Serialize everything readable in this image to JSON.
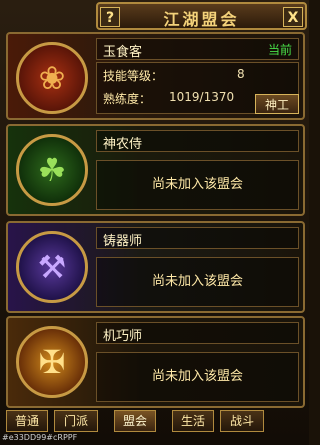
{
  "window": {
    "title": "江湖盟会",
    "help_label": "?",
    "close_label": "X"
  },
  "professions": [
    {
      "name": "玉食客",
      "current": "当前",
      "skill_level_label": "技能等级：",
      "skill_level_value": "8",
      "proficiency_label": "熟练度：",
      "proficiency_value": "1019/1370",
      "button": "神工",
      "icon": "yushike-emblem-icon"
    },
    {
      "name": "神农侍",
      "status": "尚未加入该盟会",
      "icon": "shennongshi-emblem-icon"
    },
    {
      "name": "铸器师",
      "status": "尚未加入该盟会",
      "icon": "zhuqishi-emblem-icon"
    },
    {
      "name": "机巧师",
      "status": "尚未加入该盟会",
      "icon": "jiqiaoshi-emblem-icon"
    }
  ],
  "tabs": [
    {
      "label": "普通"
    },
    {
      "label": "门派"
    },
    {
      "label": "盟会"
    },
    {
      "label": "生活"
    },
    {
      "label": "战斗"
    }
  ],
  "active_tab": "盟会",
  "footer_code": "#e33DD99#cRPPF",
  "colors": {
    "current": "#48e048",
    "title": "#f4d27a",
    "border": "#8a6a32"
  }
}
